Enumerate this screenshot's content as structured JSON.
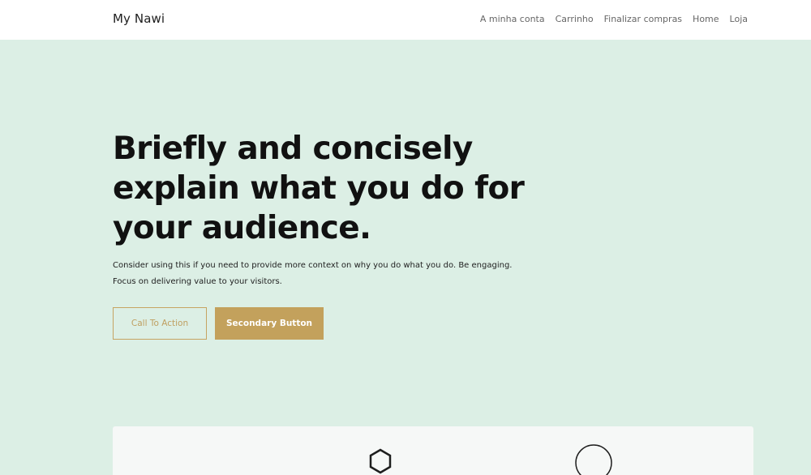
{
  "header": {
    "site_title": "My Nawi",
    "nav": [
      {
        "label": "A minha conta"
      },
      {
        "label": "Carrinho"
      },
      {
        "label": "Finalizar compras"
      },
      {
        "label": "Home"
      },
      {
        "label": "Loja"
      }
    ]
  },
  "hero": {
    "title": "Briefly and concisely explain what you do for your audience.",
    "text": "Consider using this if you need to provide more context on why you do what you do. Be engaging. Focus on delivering value to your visitors.",
    "cta_label": "Call To Action",
    "secondary_label": "Secondary Button"
  },
  "card": {
    "icons": [
      "hexagon-icon",
      "circle-icon"
    ]
  },
  "colors": {
    "hero_background": "#dcefe5",
    "accent": "#c3a15c",
    "header_background": "#ffffff"
  }
}
